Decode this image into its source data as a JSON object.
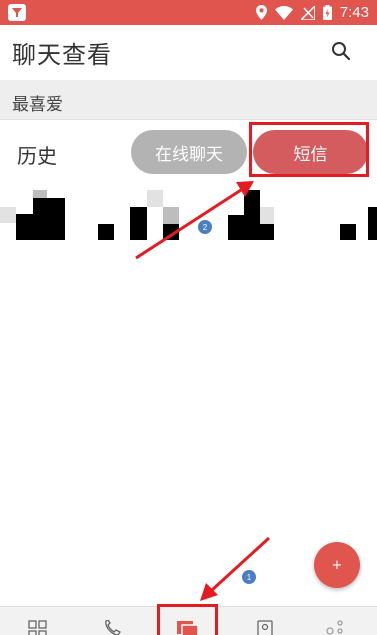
{
  "status_bar": {
    "time": "7:43",
    "icons": [
      "location-icon",
      "wifi-icon",
      "signal-icon",
      "battery-charging-icon"
    ]
  },
  "header": {
    "title": "聊天查看",
    "search_icon": "search-icon"
  },
  "favorites": {
    "label": "最喜爱"
  },
  "history": {
    "label": "历史",
    "online_chat_label": "在线聊天",
    "sms_label": "短信"
  },
  "badges": {
    "history_count": "2",
    "fab_count": "1"
  },
  "fab": {
    "label": "+"
  },
  "bottom_nav": {
    "items": [
      "grid-icon",
      "phone-icon",
      "messages-icon",
      "contacts-icon",
      "more-icon"
    ],
    "active_index": 2
  },
  "colors": {
    "brand": "#e0554d",
    "sms_pill": "#d45b5e",
    "online_pill": "#b3b3b3",
    "annotation": "#e51b21",
    "badge": "#4c7ec4"
  }
}
